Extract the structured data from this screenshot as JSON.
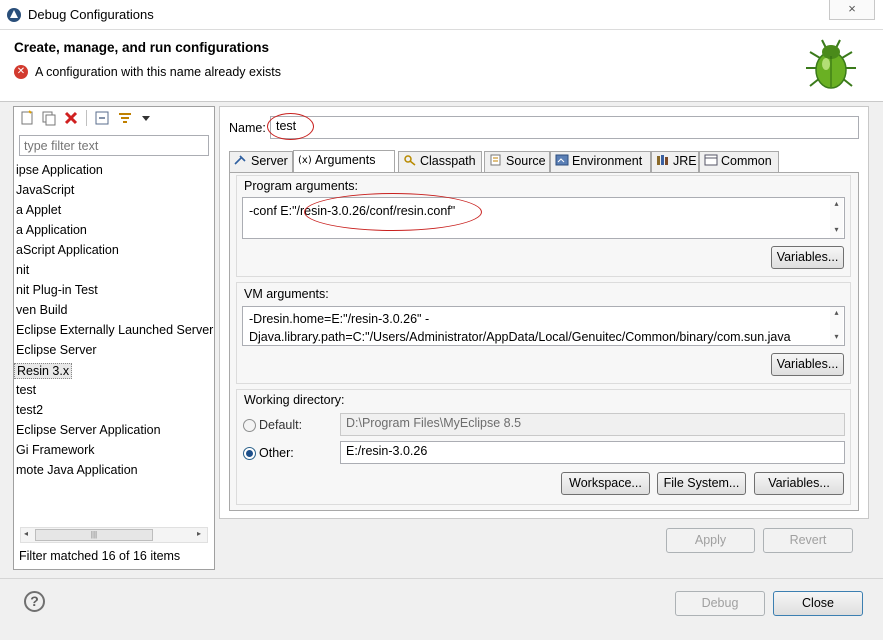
{
  "window": {
    "title": "Debug Configurations",
    "close_glyph": "×"
  },
  "header": {
    "title": "Create, manage, and run configurations",
    "error": "A configuration with this name already exists"
  },
  "left": {
    "filter_placeholder": "type filter text",
    "items": [
      "ipse Application",
      "JavaScript",
      "a Applet",
      "a Application",
      "aScript Application",
      "nit",
      "nit Plug-in Test",
      "ven Build",
      "Eclipse Externally Launched Server",
      "Eclipse Server",
      "Resin  3.x",
      "test",
      "test2",
      "Eclipse Server Application",
      "Gi Framework",
      "mote Java Application"
    ],
    "selected_index": 10,
    "scroll_left": "◂",
    "scroll_right": "▸",
    "scroll_grip": "|||",
    "status": "Filter matched 16 of 16 items"
  },
  "config": {
    "name_label": "Name:",
    "name_value": "test",
    "tabs": [
      "Server",
      "Arguments",
      "Classpath",
      "Source",
      "Environment",
      "JRE",
      "Common"
    ],
    "active_tab": 1,
    "program_args_label": "Program arguments:",
    "program_args_value": "-conf E:\"/resin-3.0.26/conf/resin.conf\"",
    "vm_args_label": "VM arguments:",
    "vm_args_line1": "-Dresin.home=E:\"/resin-3.0.26\" -",
    "vm_args_line2": "Djava.library.path=C:\"/Users/Administrator/AppData/Local/Genuitec/Common/binary/com.sun.java",
    "variables_label": "Variables...",
    "working_dir_label": "Working directory:",
    "default_label": "Default:",
    "default_value": "D:\\Program Files\\MyEclipse 8.5",
    "other_label": "Other:",
    "other_value": "E:/resin-3.0.26",
    "workspace_label": "Workspace...",
    "filesystem_label": "File System...",
    "scroll_up": "▴",
    "scroll_down": "▾",
    "apply_label": "Apply",
    "revert_label": "Revert"
  },
  "footer": {
    "help_glyph": "?",
    "debug_label": "Debug",
    "close_label": "Close"
  },
  "colors": {
    "error": "#d23a2e",
    "annotation": "#c8201e",
    "selection": "#e8e8e8"
  }
}
